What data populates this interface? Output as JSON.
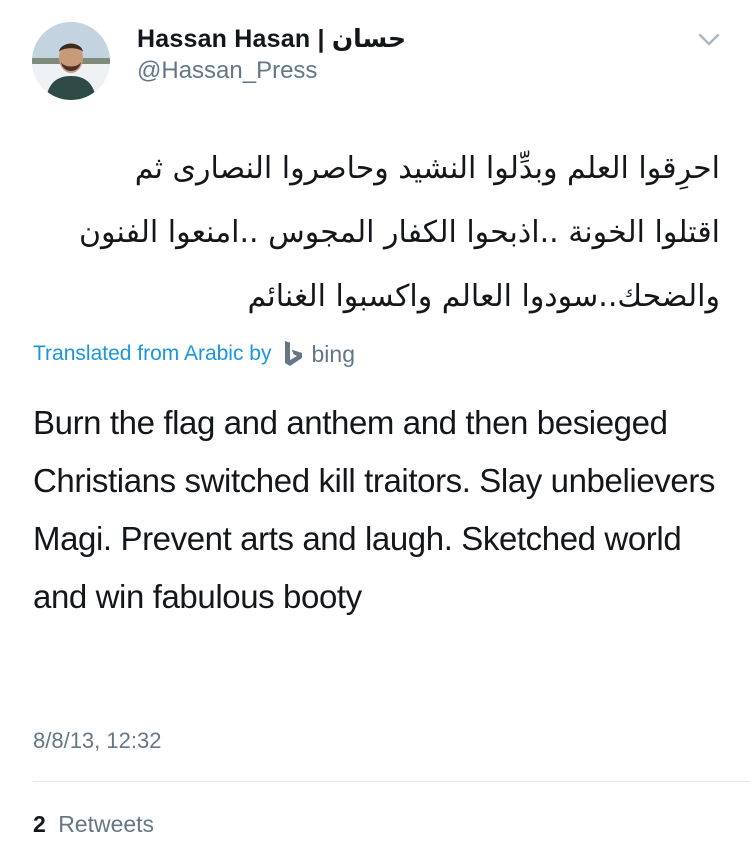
{
  "tweet": {
    "author": {
      "name": "Hassan Hasan | حسان",
      "handle": "@Hassan_Press"
    },
    "text_arabic_lines": [
      "احرِقوا العلم وبدِّلوا النشيد وحاصروا النصارى ثم",
      "اقتلوا الخونة ..اذبحوا الكفار المجوس ..امنعوا الفنون",
      "والضحك..سودوا العالم واكسبوا الغنائم"
    ],
    "translation_notice": {
      "label": "Translated from Arabic by",
      "provider": "bing"
    },
    "translation": "Burn the flag and anthem and then besieged Christians switched kill traitors. Slay unbelievers Magi. Prevent arts and laugh. Sketched world and win fabulous booty",
    "timestamp": "8/8/13, 12:32",
    "stats": {
      "retweet_count": "2",
      "retweet_label": "Retweets"
    }
  },
  "icons": {
    "menu": "chevron-down-icon",
    "translator": "bing-logo-icon"
  },
  "colors": {
    "link_blue": "#1b95e0",
    "secondary_gray": "#657786",
    "text_black": "#14171a",
    "divider": "#e1e8ed"
  }
}
